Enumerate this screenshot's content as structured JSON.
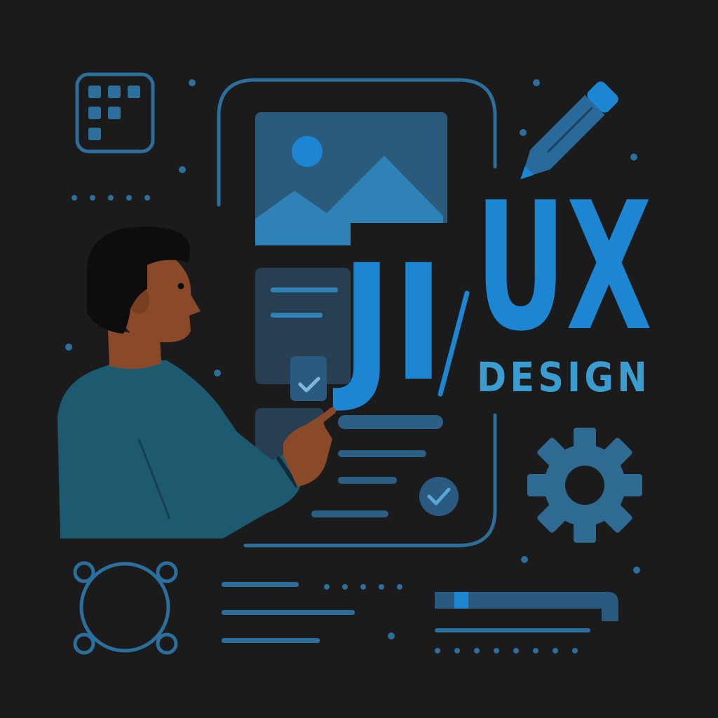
{
  "headline": {
    "left_letters": "JI",
    "right_letters": "UX",
    "subtitle": "DESIGN"
  },
  "colors": {
    "background": "#1b1b1c",
    "accent_blue": "#1d86d3",
    "line_blue": "#2c6e9c",
    "muted_blue": "#2a5a80",
    "panel_blue": "#28526f",
    "teal_sweater": "#1d5a70",
    "skin": "#8a4a2a",
    "hair": "#0d0d0d"
  },
  "icons": [
    "grid-app-icon",
    "pencil-icon",
    "image-placeholder-icon",
    "check-icon",
    "gear-icon",
    "circle-node-icon",
    "slider-bar-icon"
  ]
}
